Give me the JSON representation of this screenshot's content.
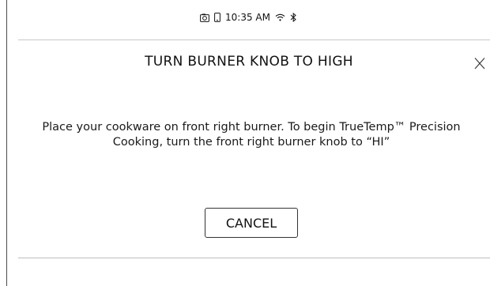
{
  "status_bar": {
    "time": "10:35 AM",
    "icons": [
      "camera-icon",
      "phone-icon",
      "wifi-icon",
      "bluetooth-icon"
    ]
  },
  "dialog": {
    "title": "TURN BURNER KNOB TO HIGH",
    "close_label": "X",
    "message": "Place your cookware on front right burner. To begin TrueTemp™ Precision Cooking, turn the front right burner knob to “HI”",
    "cancel_label": "CANCEL"
  },
  "colors": {
    "background": "#ffffff",
    "text": "#111111",
    "divider": "#c8c8c8"
  }
}
